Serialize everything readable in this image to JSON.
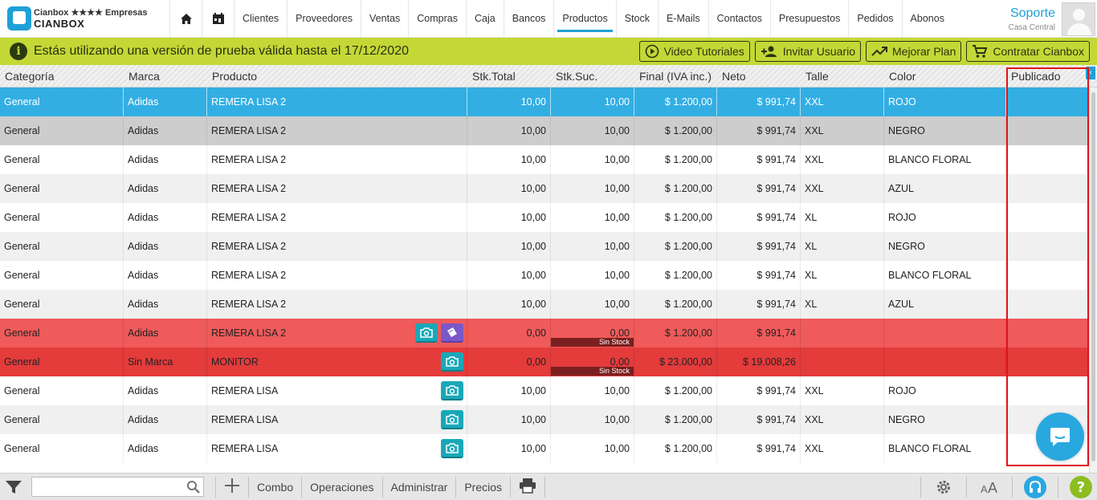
{
  "brand": {
    "line1": "Cianbox ★★★★ Empresas",
    "line2": "CIANBOX"
  },
  "nav": {
    "home_icon": "home-icon",
    "calendar_icon": "calendar-icon",
    "items": [
      "Clientes",
      "Proveedores",
      "Ventas",
      "Compras",
      "Caja",
      "Bancos",
      "Productos",
      "Stock",
      "E-Mails",
      "Contactos",
      "Presupuestos",
      "Pedidos",
      "Abonos"
    ],
    "active": "Productos"
  },
  "user": {
    "name": "Soporte",
    "branch": "Casa Central"
  },
  "banner": {
    "message": "Estás utilizando una versión de prueba válida hasta el 17/12/2020",
    "buttons": [
      "Video Tutoriales",
      "Invitar Usuario",
      "Mejorar Plan",
      "Contratar Cianbox"
    ]
  },
  "grid": {
    "columns": [
      "Categoría",
      "Marca",
      "Producto",
      "Stk.Total",
      "Stk.Suc.",
      "Final (IVA inc.)",
      "Neto",
      "Talle",
      "Color",
      "Publicado"
    ],
    "rows": [
      {
        "categoria": "General",
        "marca": "Adidas",
        "producto": "REMERA LISA 2",
        "stk_total": "10,00",
        "stk_suc": "10,00",
        "final": "$ 1.200,00",
        "neto": "$ 991,74",
        "talle": "XXL",
        "color": "ROJO",
        "publicado": ""
      },
      {
        "categoria": "General",
        "marca": "Adidas",
        "producto": "REMERA LISA 2",
        "stk_total": "10,00",
        "stk_suc": "10,00",
        "final": "$ 1.200,00",
        "neto": "$ 991,74",
        "talle": "XXL",
        "color": "NEGRO",
        "publicado": ""
      },
      {
        "categoria": "General",
        "marca": "Adidas",
        "producto": "REMERA LISA 2",
        "stk_total": "10,00",
        "stk_suc": "10,00",
        "final": "$ 1.200,00",
        "neto": "$ 991,74",
        "talle": "XXL",
        "color": "BLANCO FLORAL",
        "publicado": ""
      },
      {
        "categoria": "General",
        "marca": "Adidas",
        "producto": "REMERA LISA 2",
        "stk_total": "10,00",
        "stk_suc": "10,00",
        "final": "$ 1.200,00",
        "neto": "$ 991,74",
        "talle": "XXL",
        "color": "AZUL",
        "publicado": ""
      },
      {
        "categoria": "General",
        "marca": "Adidas",
        "producto": "REMERA LISA 2",
        "stk_total": "10,00",
        "stk_suc": "10,00",
        "final": "$ 1.200,00",
        "neto": "$ 991,74",
        "talle": "XL",
        "color": "ROJO",
        "publicado": ""
      },
      {
        "categoria": "General",
        "marca": "Adidas",
        "producto": "REMERA LISA 2",
        "stk_total": "10,00",
        "stk_suc": "10,00",
        "final": "$ 1.200,00",
        "neto": "$ 991,74",
        "talle": "XL",
        "color": "NEGRO",
        "publicado": ""
      },
      {
        "categoria": "General",
        "marca": "Adidas",
        "producto": "REMERA LISA 2",
        "stk_total": "10,00",
        "stk_suc": "10,00",
        "final": "$ 1.200,00",
        "neto": "$ 991,74",
        "talle": "XL",
        "color": "BLANCO FLORAL",
        "publicado": ""
      },
      {
        "categoria": "General",
        "marca": "Adidas",
        "producto": "REMERA LISA 2",
        "stk_total": "10,00",
        "stk_suc": "10,00",
        "final": "$ 1.200,00",
        "neto": "$ 991,74",
        "talle": "XL",
        "color": "AZUL",
        "publicado": ""
      },
      {
        "categoria": "General",
        "marca": "Adidas",
        "producto": "REMERA LISA 2",
        "stk_total": "0,00",
        "stk_suc": "0,00",
        "stock_badge": "Sin Stock",
        "final": "$ 1.200,00",
        "neto": "$ 991,74",
        "talle": "",
        "color": "",
        "publicado": ""
      },
      {
        "categoria": "General",
        "marca": "Sin Marca",
        "producto": "MONITOR",
        "stk_total": "0,00",
        "stk_suc": "0,00",
        "stock_badge": "Sin Stock",
        "final": "$ 23.000,00",
        "neto": "$ 19.008,26",
        "talle": "",
        "color": "",
        "publicado": ""
      },
      {
        "categoria": "General",
        "marca": "Adidas",
        "producto": "REMERA LISA",
        "stk_total": "10,00",
        "stk_suc": "10,00",
        "final": "$ 1.200,00",
        "neto": "$ 991,74",
        "talle": "XXL",
        "color": "ROJO",
        "publicado": ""
      },
      {
        "categoria": "General",
        "marca": "Adidas",
        "producto": "REMERA LISA",
        "stk_total": "10,00",
        "stk_suc": "10,00",
        "final": "$ 1.200,00",
        "neto": "$ 991,74",
        "talle": "XXL",
        "color": "NEGRO",
        "publicado": ""
      },
      {
        "categoria": "General",
        "marca": "Adidas",
        "producto": "REMERA LISA",
        "stk_total": "10,00",
        "stk_suc": "10,00",
        "final": "$ 1.200,00",
        "neto": "$ 991,74",
        "talle": "XXL",
        "color": "BLANCO FLORAL",
        "publicado": ""
      }
    ]
  },
  "toolbar": {
    "search_value": "",
    "items": [
      "Combo",
      "Operaciones",
      "Administrar",
      "Precios"
    ]
  },
  "colors": {
    "accent": "#1fa0d6",
    "banner": "#c3d836",
    "selected_row": "#33aee3",
    "no_stock_row": "#ef5a5a",
    "highlight": "#e0141b"
  }
}
